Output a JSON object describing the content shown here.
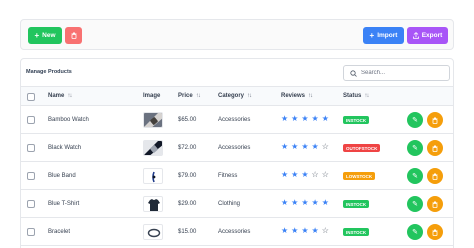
{
  "toolbar": {
    "new_label": "New",
    "import_label": "Import",
    "export_label": "Export",
    "colors": {
      "new": "#22c55e",
      "delete": "#f87171",
      "import": "#3b82f6",
      "export": "#a855f7"
    }
  },
  "table": {
    "title": "Manage Products",
    "search_placeholder": "Search...",
    "columns": {
      "name": "Name",
      "image": "Image",
      "price": "Price",
      "category": "Category",
      "reviews": "Reviews",
      "status": "Status"
    },
    "rows": [
      {
        "name": "Bamboo Watch",
        "price": "$65.00",
        "category": "Accessories",
        "rating": 5,
        "status": "INSTOCK",
        "status_color": "#22c55e",
        "image_icon": "bamboo-watch-thumbnail-icon"
      },
      {
        "name": "Black Watch",
        "price": "$72.00",
        "category": "Accessories",
        "rating": 4,
        "status": "OUTOFSTOCK",
        "status_color": "#ef4444",
        "image_icon": "black-watch-thumbnail-icon"
      },
      {
        "name": "Blue Band",
        "price": "$79.00",
        "category": "Fitness",
        "rating": 3,
        "status": "LOWSTOCK",
        "status_color": "#f59e0b",
        "image_icon": "blue-band-thumbnail-icon"
      },
      {
        "name": "Blue T-Shirt",
        "price": "$29.00",
        "category": "Clothing",
        "rating": 5,
        "status": "INSTOCK",
        "status_color": "#22c55e",
        "image_icon": "t-shirt-thumbnail-icon"
      },
      {
        "name": "Bracelet",
        "price": "$15.00",
        "category": "Accessories",
        "rating": 4,
        "status": "INSTOCK",
        "status_color": "#22c55e",
        "image_icon": "bracelet-thumbnail-icon"
      }
    ]
  },
  "icons": {
    "new": "plus-icon",
    "delete": "trash-icon",
    "import": "plus-icon",
    "export": "upload-icon",
    "search": "search-icon",
    "sort": "sort-icon",
    "edit": "pencil-icon",
    "row_delete": "trash-icon"
  },
  "colors": {
    "accent": "#3b82f6",
    "star_empty": "#4b5563"
  }
}
